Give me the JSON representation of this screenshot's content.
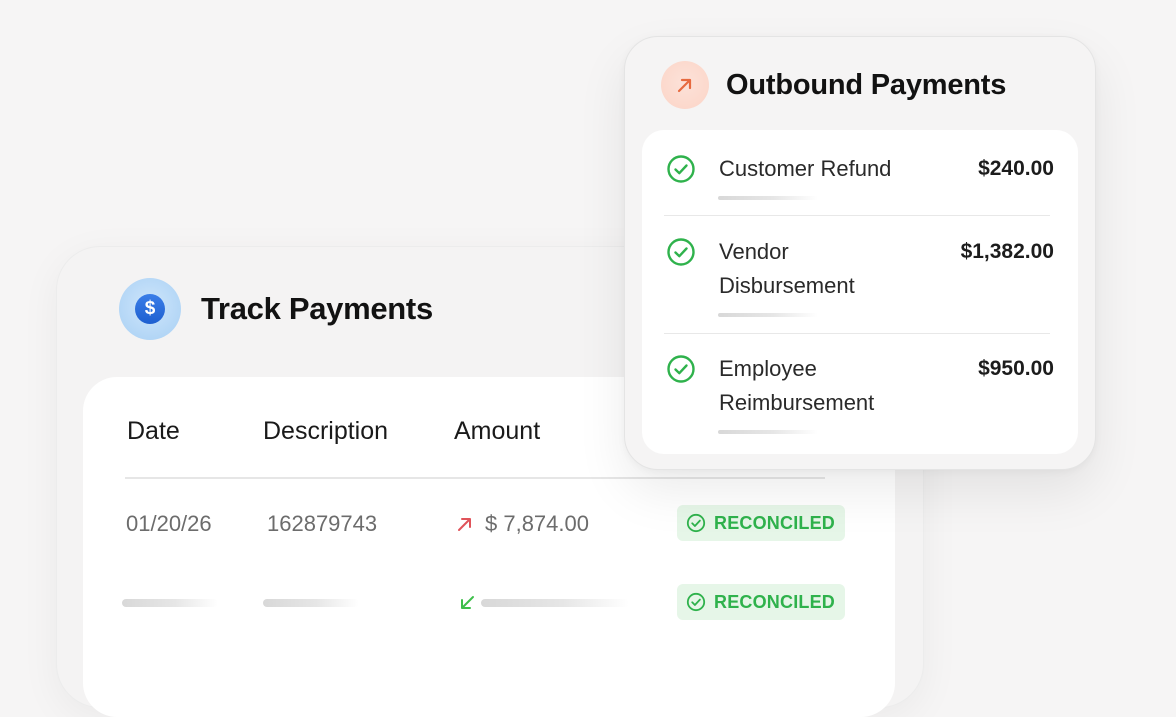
{
  "track": {
    "title": "Track Payments",
    "icon": "dollar-icon",
    "columns": {
      "date": "Date",
      "description": "Description",
      "amount": "Amount"
    },
    "rows": [
      {
        "date": "01/20/26",
        "description": "162879743",
        "amount": "$ 7,874.00",
        "direction_icon": "arrow-up-right-icon",
        "status": "RECONCILED"
      },
      {
        "direction_icon": "arrow-down-left-icon",
        "status": "RECONCILED"
      }
    ]
  },
  "outbound": {
    "title": "Outbound Payments",
    "icon": "arrow-up-right-icon",
    "items": [
      {
        "label": "Customer Refund",
        "amount": "$240.00"
      },
      {
        "label_line1": "Vendor",
        "label_line2": "Disbursement",
        "amount": "$1,382.00"
      },
      {
        "label_line1": "Employee",
        "label_line2": "Reimbursement",
        "amount": "$950.00"
      }
    ]
  },
  "colors": {
    "reconciled_text": "#2fb24c",
    "reconciled_bg": "#e6f6e8",
    "outbound_arrow": "#e76a3f",
    "inbound_arrow": "#3dbf4a",
    "dollar_badge": "#1e5fd0"
  }
}
